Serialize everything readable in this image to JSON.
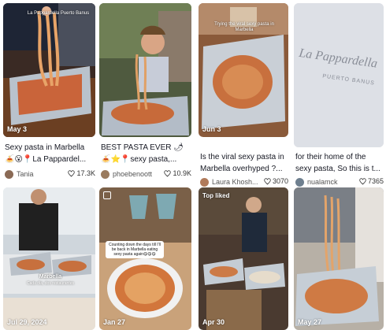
{
  "colors": {
    "text": "#161823",
    "muted": "#555555",
    "heart": "#333333"
  },
  "videos": [
    {
      "date": "May 3",
      "overlay_text": "La Pappardella Puerto Banus",
      "caption_line1": "Sexy pasta in Marbella",
      "caption_line2": "🍝😮📍La Pappardel...",
      "author": "Tania",
      "likes": "17.3K"
    },
    {
      "date": "",
      "overlay_text": "",
      "caption_line1": "BEST PASTA EVER 🌶",
      "caption_line2": "🍝⭐📍sexy pasta,...",
      "author": "phoebenoott",
      "likes": "10.9K"
    },
    {
      "date": "Jun 3",
      "overlay_text": "Trying the viral sexy pasta in Marbella",
      "caption_line1": "Is the viral sexy pasta in",
      "caption_line2": "Marbella overhyped ?...",
      "author": "Laura Khosh...",
      "likes": "3070"
    },
    {
      "date": "",
      "overlay_text": "",
      "sign_text": "La Pappardella",
      "sign_sub": "PUERTO BANUS",
      "caption_line1": "for their home of the",
      "caption_line2": "sexy pasta, So this is t...",
      "author": "nualamck",
      "likes": "7365"
    },
    {
      "date": "Jul 29, 2024",
      "overlay_text": "Marbella",
      "overlay_sub": "Cada dia, dos restaurantes"
    },
    {
      "date": "Jan 27",
      "overlay_text": "Counting down the days till I'll be back in Marbella eating sexy pasta again😋😋😋"
    },
    {
      "date": "Apr 30",
      "top_badge": "Top liked"
    },
    {
      "date": "May 27"
    }
  ]
}
